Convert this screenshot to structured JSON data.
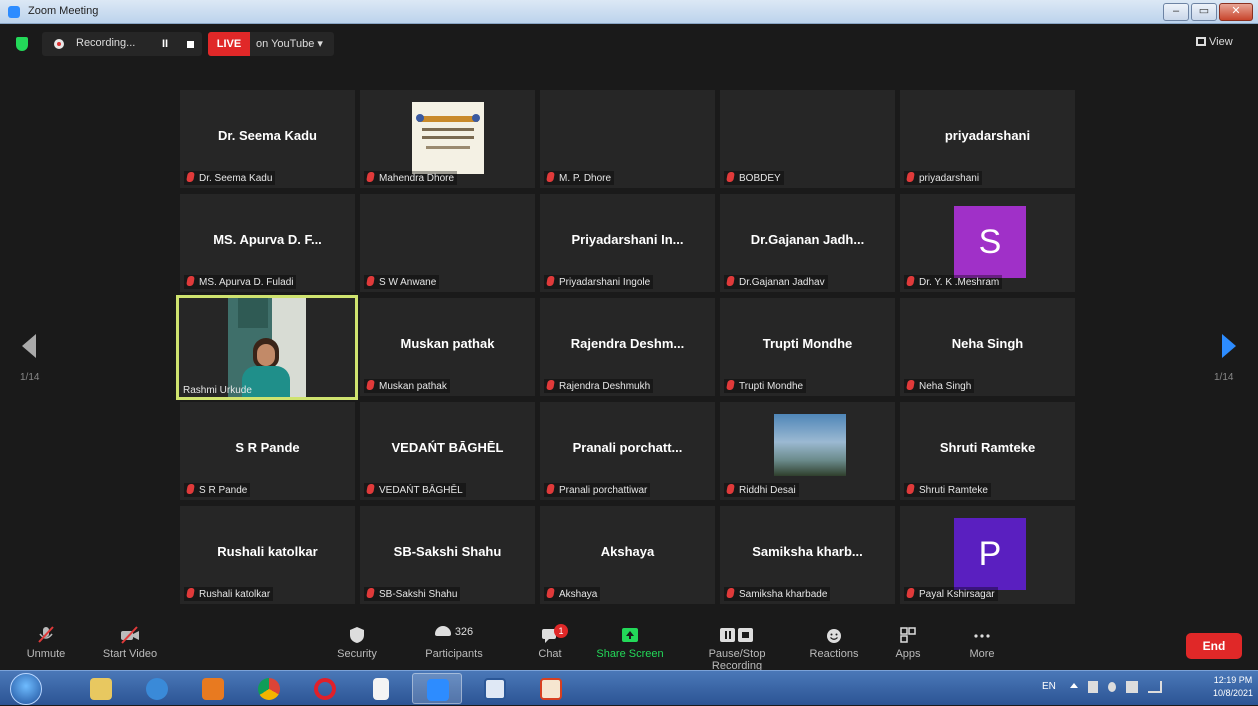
{
  "window": {
    "title": "Zoom Meeting",
    "controls": [
      "–",
      "▭",
      "✕"
    ]
  },
  "topbar": {
    "recording_label": "Recording...",
    "pause_label": "II",
    "live_badge": "LIVE",
    "live_target": "on YouTube ▾",
    "view_label": "View"
  },
  "pagination": {
    "left": "1/14",
    "right": "1/14"
  },
  "tiles": [
    {
      "big": "Dr. Seema Kadu",
      "tag": "Dr. Seema Kadu"
    },
    {
      "big": "",
      "tag": "Mahendra Dhore"
    },
    {
      "big": "",
      "tag": "M. P. Dhore"
    },
    {
      "big": "",
      "tag": "BOBDEY"
    },
    {
      "big": "priyadarshani",
      "tag": "priyadarshani"
    },
    {
      "big": "MS. Apurva D. F...",
      "tag": "MS. Apurva D. Fuladi"
    },
    {
      "big": "",
      "tag": "S W Anwane"
    },
    {
      "big": "Priyadarshani In...",
      "tag": "Priyadarshani Ingole"
    },
    {
      "big": "Dr.Gajanan Jadh...",
      "tag": "Dr.Gajanan Jadhav"
    },
    {
      "big": "",
      "tag": "Dr. Y. K .Meshram",
      "avatar": "S"
    },
    {
      "big": "",
      "tag": "Rashmi Urkude"
    },
    {
      "big": "Muskan pathak",
      "tag": "Muskan pathak"
    },
    {
      "big": "Rajendra Deshm...",
      "tag": "Rajendra Deshmukh"
    },
    {
      "big": "Trupti Mondhe",
      "tag": "Trupti Mondhe"
    },
    {
      "big": "Neha Singh",
      "tag": "Neha Singh"
    },
    {
      "big": "S R Pande",
      "tag": "S R Pande"
    },
    {
      "big": "VEDAŃT BĀGHĒL",
      "tag": "VEDAŃT BĀGHĒL"
    },
    {
      "big": "Pranali porchatt...",
      "tag": "Pranali porchattiwar"
    },
    {
      "big": "",
      "tag": "Riddhi Desai"
    },
    {
      "big": "Shruti Ramteke",
      "tag": "Shruti Ramteke"
    },
    {
      "big": "Rushali katolkar",
      "tag": "Rushali katolkar"
    },
    {
      "big": "SB-Sakshi Shahu",
      "tag": "SB-Sakshi Shahu"
    },
    {
      "big": "Akshaya",
      "tag": "Akshaya"
    },
    {
      "big": "Samiksha kharb...",
      "tag": "Samiksha kharbade"
    },
    {
      "big": "",
      "tag": "Payal Kshirsagar",
      "avatar": "P"
    }
  ],
  "toolbar": {
    "unmute": "Unmute",
    "start_video": "Start Video",
    "security": "Security",
    "participants": "Participants",
    "participants_count": "326",
    "chat": "Chat",
    "chat_badge": "1",
    "share_screen": "Share Screen",
    "pause_stop_recording": "Pause/Stop Recording",
    "reactions": "Reactions",
    "apps": "Apps",
    "more": "More",
    "end": "End"
  },
  "taskbar": {
    "lang": "EN",
    "time": "12:19 PM",
    "date": "10/8/2021"
  },
  "colors": {
    "live_red": "#e02828",
    "share_green": "#23d959",
    "active_speaker_border": "#cfe36f",
    "avatar_s": "#a030c8",
    "avatar_p": "#5a1fc0"
  }
}
